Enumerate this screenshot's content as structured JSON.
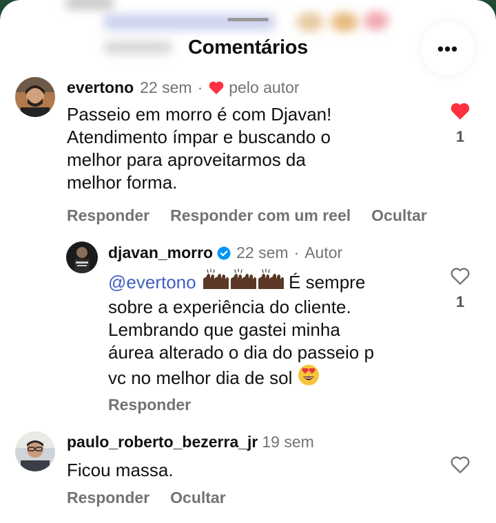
{
  "sheet": {
    "title": "Comentários"
  },
  "comments": [
    {
      "username": "evertono",
      "time": "22 sem",
      "separator": "·",
      "author_like_label": "pelo autor",
      "text": "Passeio em morro é com Djavan!\nAtendimento ímpar e buscando o\nmelhor para aproveitarmos da\nmelhor forma.",
      "likes": "1",
      "liked": true,
      "actions": {
        "reply": "Responder",
        "reply_reel": "Responder com um reel",
        "hide": "Ocultar"
      },
      "reply": {
        "username": "djavan_morro",
        "verified": true,
        "time": "22 sem",
        "separator": "·",
        "author_badge": "Autor",
        "mention": "@evertono",
        "text_after_emojis": " É sempre",
        "text_rest": "sobre a experiência do cliente.\nLembrando que gastei minha\náurea alterado o dia do passeio p\nvc no melhor dia de sol ",
        "likes": "1",
        "actions": {
          "reply": "Responder"
        }
      }
    },
    {
      "username": "paulo_roberto_bezerra_jr",
      "time": "19 sem",
      "text": "Ficou massa.",
      "actions": {
        "reply": "Responder",
        "hide": "Ocultar"
      }
    }
  ],
  "colors": {
    "like_red": "#ff3040",
    "verified_blue": "#0095f6",
    "mention_blue": "#3f5fbf",
    "secondary_text": "#737373"
  }
}
